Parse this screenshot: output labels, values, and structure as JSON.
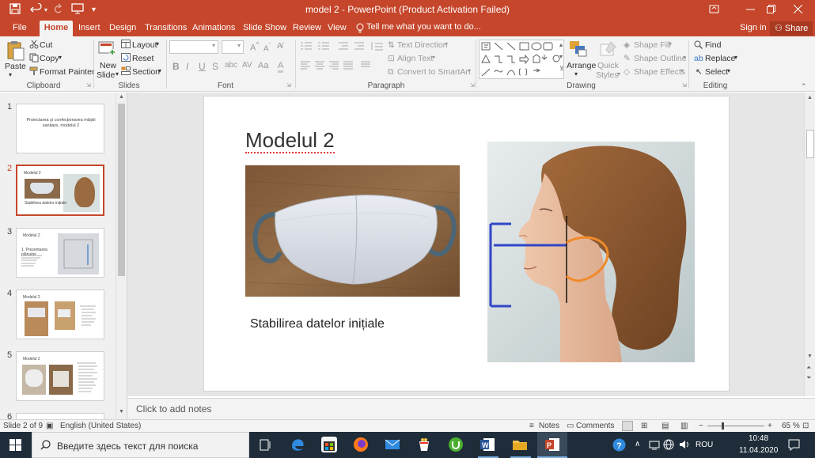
{
  "titlebar": {
    "title": "model 2 - PowerPoint (Product Activation Failed)",
    "save_icon": "save-icon",
    "undo_icon": "undo-icon",
    "redo_icon": "redo-icon",
    "present_icon": "present-from-start-icon",
    "customize_icon": "customize-qat-icon",
    "ribbon_display_icon": "ribbon-display-options-icon",
    "minimize_icon": "minimize-icon",
    "restore_icon": "restore-icon",
    "close_icon": "close-icon"
  },
  "menu": {
    "tabs": [
      "File",
      "Home",
      "Insert",
      "Design",
      "Transitions",
      "Animations",
      "Slide Show",
      "Review",
      "View"
    ],
    "active_tab": "Home",
    "tell_me": "Tell me what you want to do...",
    "sign_in": "Sign in",
    "share": "Share"
  },
  "ribbon": {
    "clipboard": {
      "paste": "Paste",
      "cut": "Cut",
      "copy": "Copy",
      "format_painter": "Format Painter",
      "label": "Clipboard"
    },
    "slides": {
      "new_slide": "New",
      "new_slide_2": "Slide",
      "layout": "Layout",
      "reset": "Reset",
      "section": "Section",
      "label": "Slides"
    },
    "font": {
      "bold": "B",
      "italic": "I",
      "underline": "U",
      "strike": "S",
      "label": "Font"
    },
    "paragraph": {
      "text_direction": "Text Direction",
      "align_text": "Align Text",
      "convert_smartart": "Convert to SmartArt",
      "label": "Paragraph"
    },
    "drawing": {
      "arrange": "Arrange",
      "quick_styles": "Quick",
      "quick_styles_2": "Styles",
      "shape_fill": "Shape Fill",
      "shape_outline": "Shape Outline",
      "shape_effects": "Shape Effects",
      "label": "Drawing"
    },
    "editing": {
      "find": "Find",
      "replace": "Replace",
      "select": "Select",
      "label": "Editing"
    }
  },
  "thumbnails": [
    {
      "num": "1",
      "text": "Proiectarea și confecționarea măștii sanitare, modelul 2"
    },
    {
      "num": "2",
      "title": "Modelul 2",
      "caption": "Stabilirea datelor inițiale"
    },
    {
      "num": "3",
      "title": "Modelul 2",
      "text": "1. Prezentarea plănuitei"
    },
    {
      "num": "4",
      "title": "Modelul 2"
    },
    {
      "num": "5",
      "title": "Modelul 2"
    },
    {
      "num": "6"
    }
  ],
  "slide": {
    "title": "Modelul 2",
    "caption": "Stabilirea datelor inițiale"
  },
  "notes": {
    "placeholder": "Click to add notes"
  },
  "status": {
    "slide_info": "Slide 2 of 9",
    "language": "English (United States)",
    "notes": "Notes",
    "comments": "Comments",
    "zoom": "65 %"
  },
  "taskbar": {
    "search_placeholder": "Введите здесь текст для поиска",
    "lang": "ROU",
    "time": "10:48",
    "date": "11.04.2020"
  },
  "colors": {
    "accent": "#c5462b",
    "taskbar": "#1f2d3a",
    "face_line_blue": "#3046c8",
    "face_line_orange": "#f08a2a"
  }
}
